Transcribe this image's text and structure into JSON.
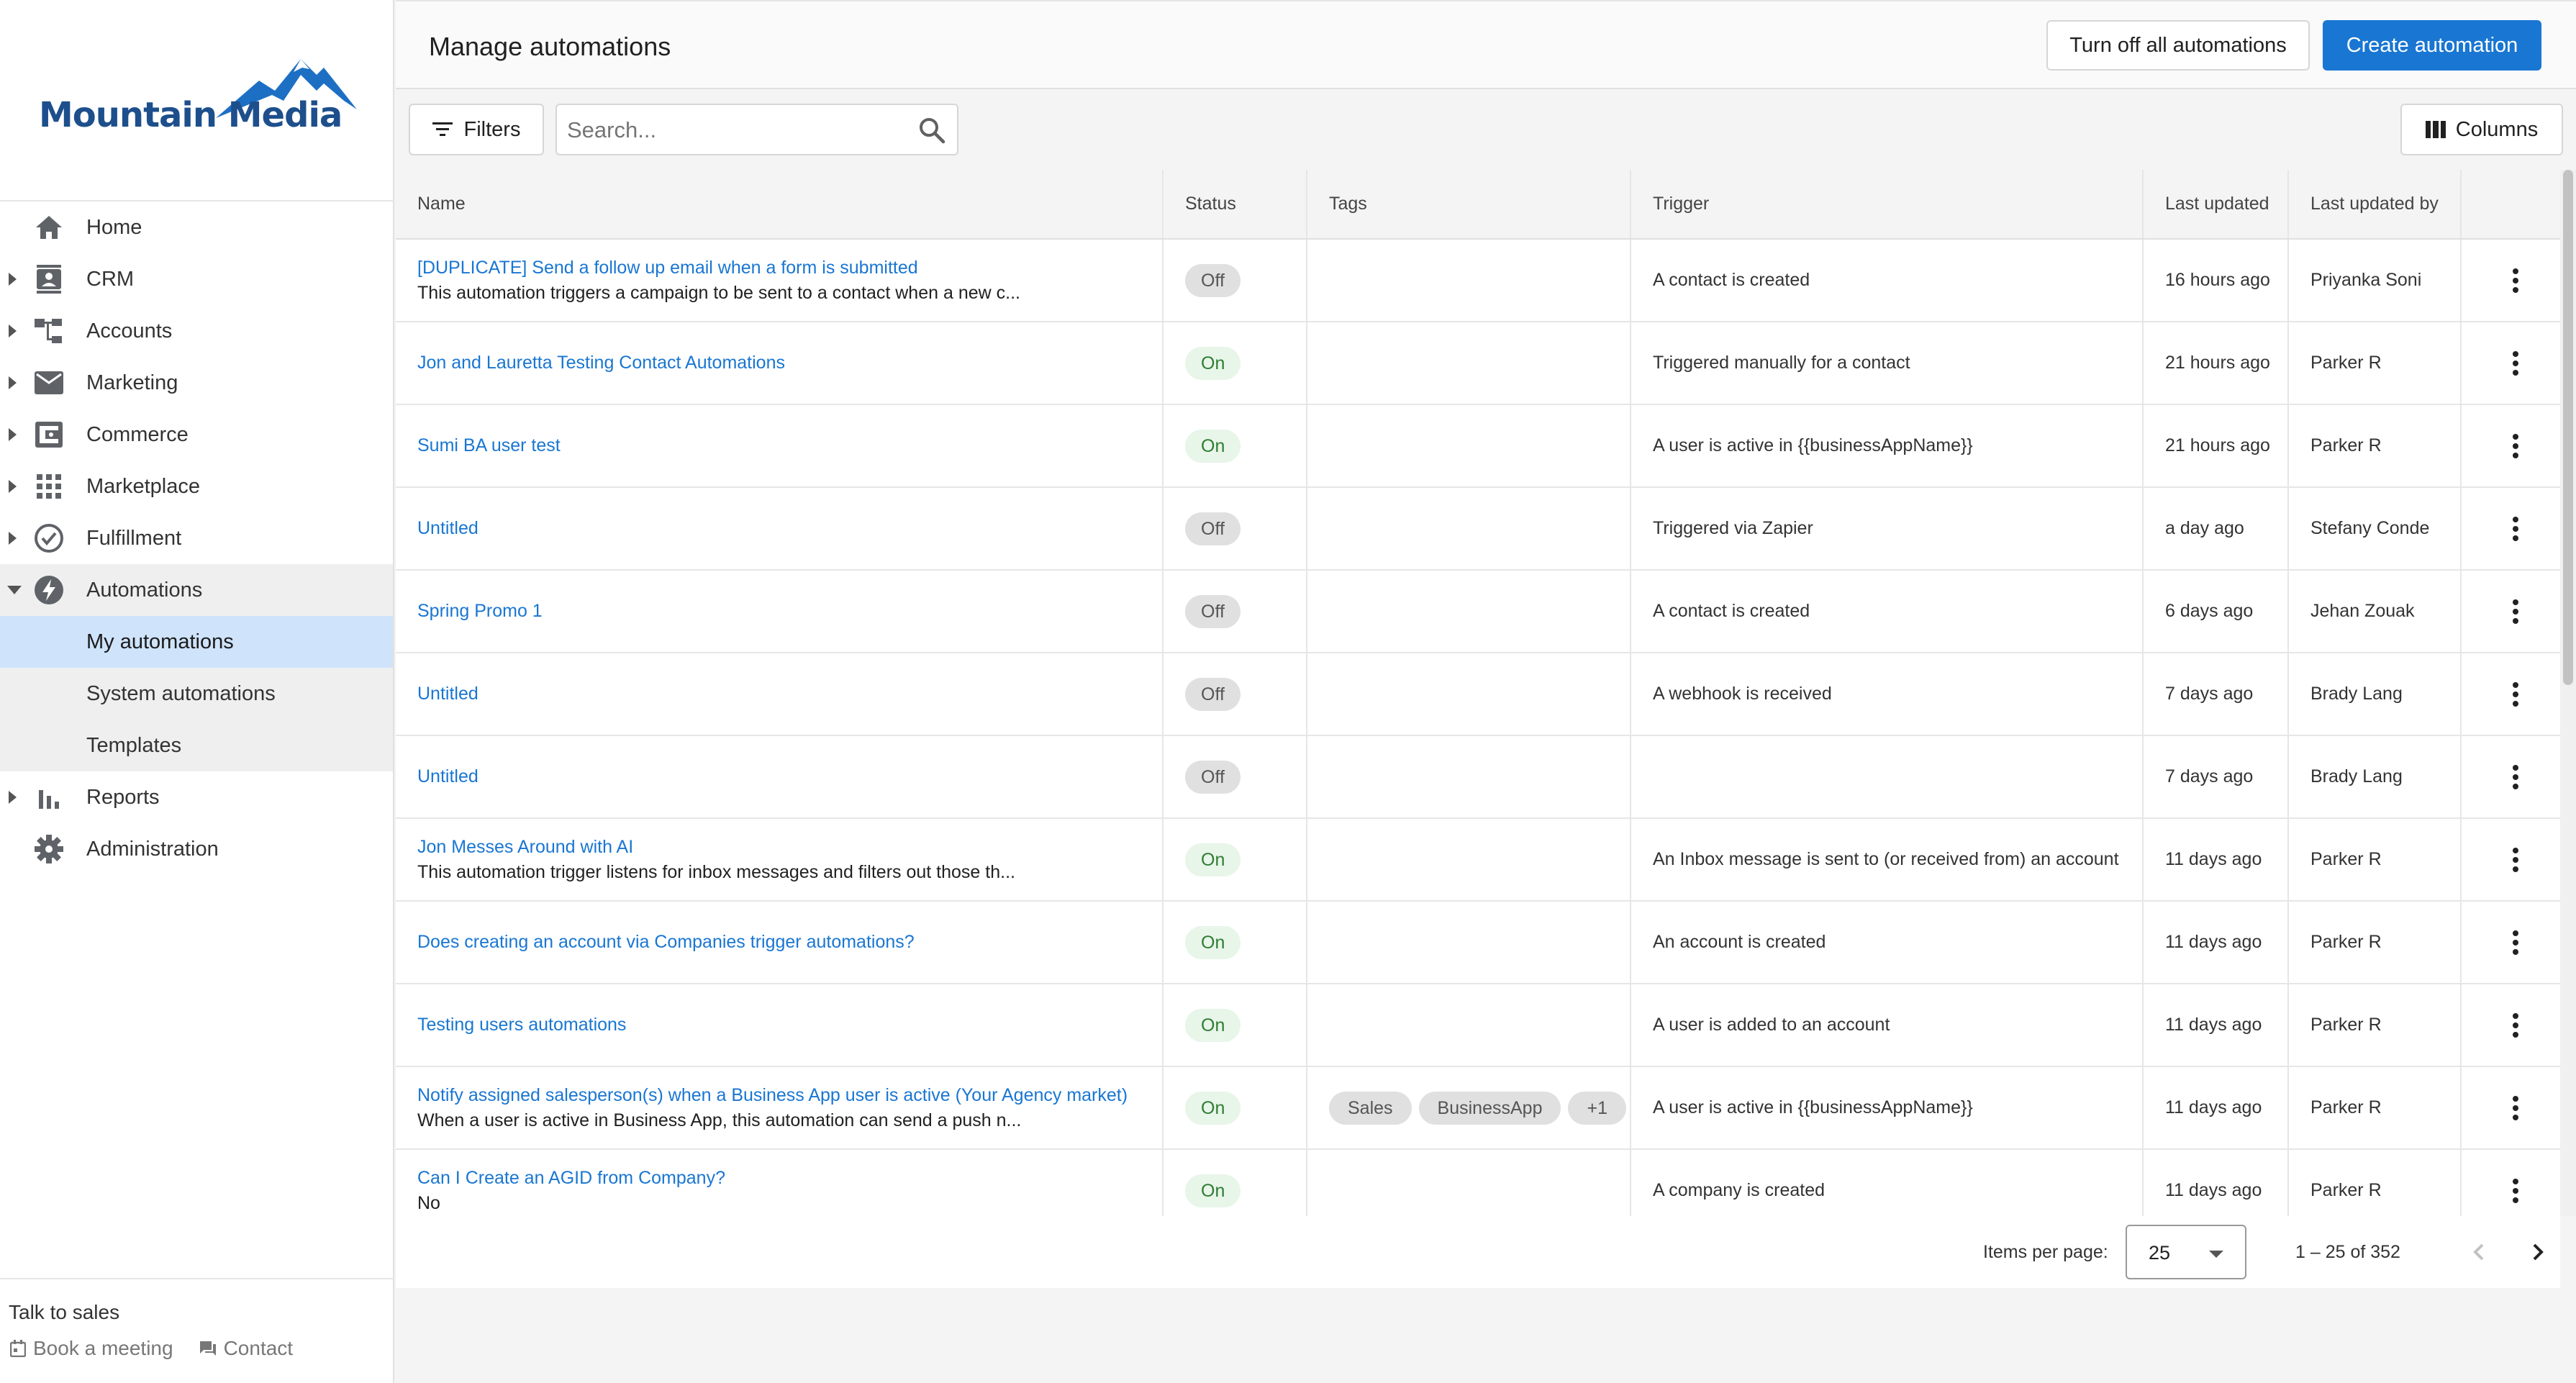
{
  "brand": {
    "name": "Mountain Media",
    "color": "#1d4f8c"
  },
  "sidebar": {
    "items": [
      {
        "label": "Home",
        "icon": "home-icon",
        "expandable": false
      },
      {
        "label": "CRM",
        "icon": "contacts-icon",
        "expandable": true
      },
      {
        "label": "Accounts",
        "icon": "accounts-tree-icon",
        "expandable": true
      },
      {
        "label": "Marketing",
        "icon": "mail-icon",
        "expandable": true
      },
      {
        "label": "Commerce",
        "icon": "wallet-icon",
        "expandable": true
      },
      {
        "label": "Marketplace",
        "icon": "grid-icon",
        "expandable": true
      },
      {
        "label": "Fulfillment",
        "icon": "check-circle-icon",
        "expandable": true
      },
      {
        "label": "Automations",
        "icon": "bolt-icon",
        "expandable": true,
        "expanded": true
      },
      {
        "label": "Reports",
        "icon": "bar-chart-icon",
        "expandable": true
      },
      {
        "label": "Administration",
        "icon": "gear-icon",
        "expandable": false
      }
    ],
    "automations_children": [
      {
        "label": "My automations",
        "active": true
      },
      {
        "label": "System automations",
        "active": false
      },
      {
        "label": "Templates",
        "active": false
      }
    ],
    "talk_to_sales": "Talk to sales",
    "book_meeting": "Book a meeting",
    "contact": "Contact"
  },
  "header": {
    "title": "Manage automations",
    "turn_off_all": "Turn off all automations",
    "create": "Create automation",
    "accent_color": "#1976d2"
  },
  "toolbar": {
    "filters": "Filters",
    "search_placeholder": "Search...",
    "columns": "Columns"
  },
  "table": {
    "columns": [
      "Name",
      "Status",
      "Tags",
      "Trigger",
      "Last updated",
      "Last updated by"
    ],
    "rows": [
      {
        "name": "[DUPLICATE] Send a follow up email when a form is submitted",
        "desc": "This automation triggers a campaign to be sent to a contact when a new c...",
        "status": "Off",
        "tags": [],
        "trigger": "A contact is created",
        "updated": "16 hours ago",
        "by": "Priyanka Soni"
      },
      {
        "name": "Jon and Lauretta Testing Contact Automations",
        "desc": "",
        "status": "On",
        "tags": [],
        "trigger": "Triggered manually for a contact",
        "updated": "21 hours ago",
        "by": "Parker R"
      },
      {
        "name": "Sumi BA user test",
        "desc": "",
        "status": "On",
        "tags": [],
        "trigger": "A user is active in {{businessAppName}}",
        "updated": "21 hours ago",
        "by": "Parker R"
      },
      {
        "name": "Untitled",
        "desc": "",
        "status": "Off",
        "tags": [],
        "trigger": "Triggered via Zapier",
        "updated": "a day ago",
        "by": "Stefany Conde"
      },
      {
        "name": "Spring Promo 1",
        "desc": "",
        "status": "Off",
        "tags": [],
        "trigger": "A contact is created",
        "updated": "6 days ago",
        "by": "Jehan Zouak"
      },
      {
        "name": "Untitled",
        "desc": "",
        "status": "Off",
        "tags": [],
        "trigger": "A webhook is received",
        "updated": "7 days ago",
        "by": "Brady Lang"
      },
      {
        "name": "Untitled",
        "desc": "",
        "status": "Off",
        "tags": [],
        "trigger": "",
        "updated": "7 days ago",
        "by": "Brady Lang"
      },
      {
        "name": "Jon Messes Around with AI",
        "desc": "This automation trigger listens for inbox messages and filters out those th...",
        "status": "On",
        "tags": [],
        "trigger": "An Inbox message is sent to (or received from) an account",
        "updated": "11 days ago",
        "by": "Parker R"
      },
      {
        "name": "Does creating an account via Companies trigger automations?",
        "desc": "",
        "status": "On",
        "tags": [],
        "trigger": "An account is created",
        "updated": "11 days ago",
        "by": "Parker R"
      },
      {
        "name": "Testing users automations",
        "desc": "",
        "status": "On",
        "tags": [],
        "trigger": "A user is added to an account",
        "updated": "11 days ago",
        "by": "Parker R"
      },
      {
        "name": "Notify assigned salesperson(s) when a Business App user is active (Your Agency market)",
        "desc": "When a user is active in Business App, this automation can send a push n...",
        "status": "On",
        "tags": [
          "Sales",
          "BusinessApp",
          "+1"
        ],
        "trigger": "A user is active in {{businessAppName}}",
        "updated": "11 days ago",
        "by": "Parker R"
      },
      {
        "name": "Can I Create an AGID from Company?",
        "desc": "No",
        "status": "On",
        "tags": [],
        "trigger": "A company is created",
        "updated": "11 days ago",
        "by": "Parker R"
      }
    ]
  },
  "paginator": {
    "items_per_page_label": "Items per page:",
    "items_per_page": "25",
    "range": "1 – 25 of 352"
  }
}
